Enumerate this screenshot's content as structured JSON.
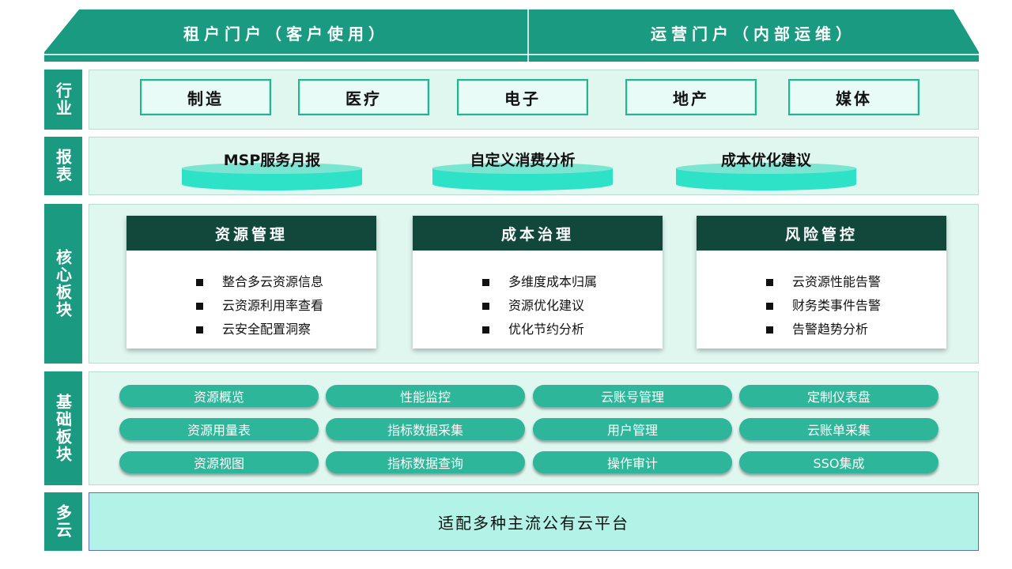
{
  "portal": {
    "tenant": "租户门户（客户使用）",
    "ops": "运营门户（内部运维）"
  },
  "rows": {
    "industry": "行业",
    "report": "报表",
    "core": "核心板块",
    "base": "基础板块",
    "cloud": "多云"
  },
  "industries": [
    "制造",
    "医疗",
    "电子",
    "地产",
    "媒体"
  ],
  "reports": [
    "MSP服务月报",
    "自定义消费分析",
    "成本优化建议"
  ],
  "core_modules": [
    {
      "title": "资源管理",
      "items": [
        "整合多云资源信息",
        "云资源利用率查看",
        "云安全配置洞察"
      ]
    },
    {
      "title": "成本治理",
      "items": [
        "多维度成本归属",
        "资源优化建议",
        "优化节约分析"
      ]
    },
    {
      "title": "风险管控",
      "items": [
        "云资源性能告警",
        "财务类事件告警",
        "告警趋势分析"
      ]
    }
  ],
  "base_modules": [
    [
      "资源概览",
      "性能监控",
      "云账号管理",
      "定制仪表盘"
    ],
    [
      "资源用量表",
      "指标数据采集",
      "用户管理",
      "云账单采集"
    ],
    [
      "资源视图",
      "指标数据查询",
      "操作审计",
      "SSO集成"
    ]
  ],
  "cloud_platform": "适配多种主流公有云平台",
  "colors": {
    "roof": "#1a9a80",
    "side": "#1a9a80",
    "panel": "#e0f7f0",
    "card_head": "#11483b",
    "pill": "#2eb69a",
    "cylinder": "#2ee2c7",
    "cloud_panel": "#b3f2e6"
  }
}
